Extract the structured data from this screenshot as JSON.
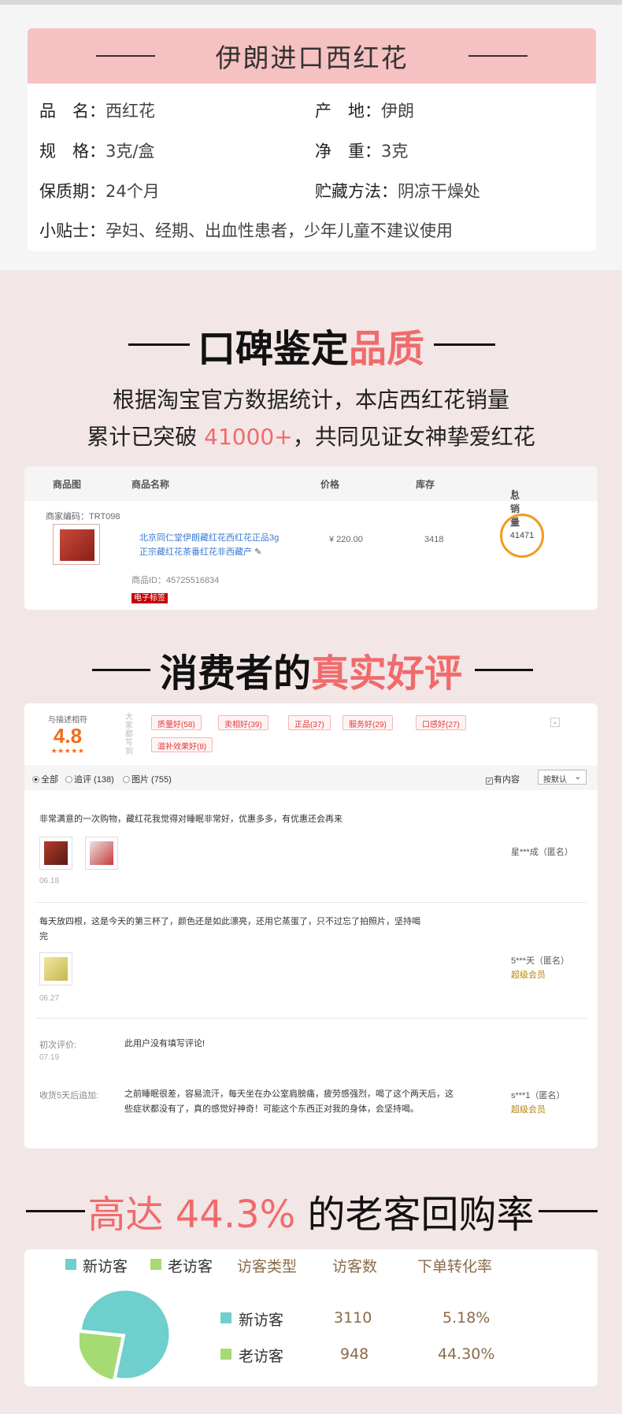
{
  "spec": {
    "title": "伊朗进口西红花",
    "rows": [
      {
        "label": "品　名：",
        "value": "西红花"
      },
      {
        "label": "产　地：",
        "value": "伊朗"
      },
      {
        "label": "规　格：",
        "value": "3克/盒"
      },
      {
        "label": "净　重：",
        "value": "3克"
      },
      {
        "label": "保质期：",
        "value": "24个月"
      },
      {
        "label": "贮藏方法：",
        "value": "阴凉干燥处"
      },
      {
        "label": "小贴士：",
        "value": "孕妇、经期、出血性患者，少年儿童不建议使用"
      }
    ]
  },
  "section_reputation": {
    "heading_plain": "口碑鉴定",
    "heading_highlight": "品质",
    "desc_line1": "根据淘宝官方数据统计，本店西红花销量",
    "desc_line2_pre": "累计已突破 ",
    "desc_line2_num": "41000+",
    "desc_line2_post": "，共同见证女神挚爱红花"
  },
  "sales_table": {
    "headers": {
      "image": "商品图",
      "name": "商品名称",
      "price": "价格",
      "stock": "库存",
      "total": "总销量"
    },
    "sort_icon": "sort-arrows-icon",
    "merchant_code": "商家编码：TRT098",
    "product_name_line1": "北京同仁堂伊朗藏红花西红花正品3g",
    "product_name_line2": "正宗藏红花茶番红花非西藏产",
    "product_id": "商品ID：45725516834",
    "e_tag": "电子标签",
    "price": "¥  220.00",
    "stock": "3418",
    "total_sales": "41471"
  },
  "section_reviews": {
    "heading_plain": "消费者的",
    "heading_highlight": "真实好评"
  },
  "reviews": {
    "score_label": "与描述相符",
    "score": "4.8",
    "stars": "★★★★★",
    "tags_caption": "大家都写到",
    "tags": [
      "质量好(58)",
      "卖相好(39)",
      "正品(37)",
      "服务好(29)",
      "口感好(27)",
      "滋补效果好(8)"
    ],
    "filter": {
      "all": "全部",
      "followup": "追评 (138)",
      "pictures": "图片 (755)",
      "has_content": "有内容",
      "sort": "按默认"
    },
    "items": [
      {
        "text": "非常满意的一次购物，藏红花我觉得对睡眠非常好，优惠多多，有优惠还会再来",
        "date": "06.18",
        "user": "星***成（匿名）",
        "member": ""
      },
      {
        "text": "每天放四根，这是今天的第三杯了，颜色还是如此漂亮，还用它蒸蛋了，只不过忘了拍照片，坚持喝完",
        "date": "06.27",
        "user": "5***天（匿名）",
        "member": "超级会员"
      }
    ],
    "third": {
      "first_label": "初次评价:",
      "first_date": "07.19",
      "first_text": "此用户没有填写评论!",
      "followup_label": "收货5天后追加:",
      "followup_text": "之前睡眠很差，容易流汗，每天坐在办公室肩膀痛，疲劳感强烈，喝了这个两天后，这些症状都没有了，真的感觉好神奇！可能这个东西正对我的身体，会坚持喝。",
      "user": "s***1（匿名）",
      "member": "超级会员"
    }
  },
  "section_repurchase": {
    "heading_highlight": "高达 44.3%",
    "heading_plain": " 的老客回购率"
  },
  "visitors": {
    "legend": [
      "新访客",
      "老访客"
    ],
    "headers": [
      "访客类型",
      "访客数",
      "下单转化率"
    ],
    "rows": [
      {
        "type": "新访客",
        "count": "3110",
        "rate": "5.18%"
      },
      {
        "type": "老访客",
        "count": "948",
        "rate": "44.30%"
      }
    ],
    "colors": {
      "new": "#6ecfcc",
      "old": "#a6da73"
    },
    "chart_data": {
      "type": "pie",
      "categories": [
        "新访客",
        "老访客"
      ],
      "values": [
        3110,
        948
      ]
    }
  }
}
